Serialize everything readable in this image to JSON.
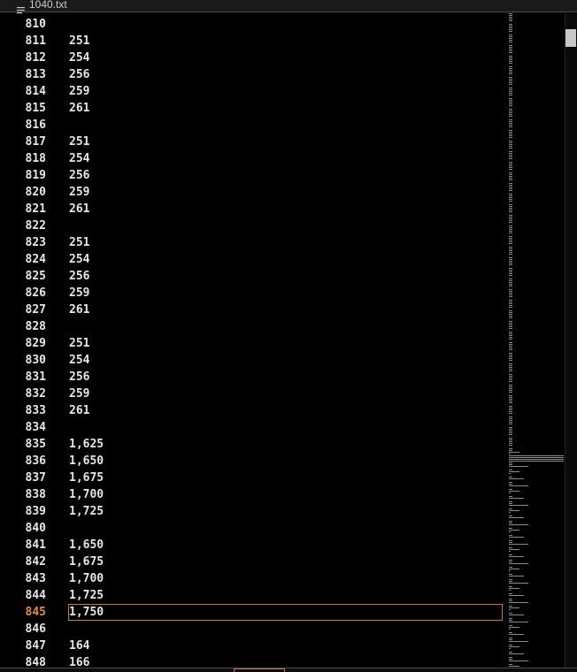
{
  "tab": {
    "title": "1040.txt",
    "icon": "text-file-icon"
  },
  "colors": {
    "background": "#000000",
    "text": "#e6e6e6",
    "current_line_number": "#e08a4e",
    "current_line_border": "#c27a52"
  },
  "editor": {
    "current_line": "845",
    "lines": [
      {
        "n": "810",
        "t": ""
      },
      {
        "n": "811",
        "t": "251"
      },
      {
        "n": "812",
        "t": "254"
      },
      {
        "n": "813",
        "t": "256"
      },
      {
        "n": "814",
        "t": "259"
      },
      {
        "n": "815",
        "t": "261"
      },
      {
        "n": "816",
        "t": ""
      },
      {
        "n": "817",
        "t": "251"
      },
      {
        "n": "818",
        "t": "254"
      },
      {
        "n": "819",
        "t": "256"
      },
      {
        "n": "820",
        "t": "259"
      },
      {
        "n": "821",
        "t": "261"
      },
      {
        "n": "822",
        "t": ""
      },
      {
        "n": "823",
        "t": "251"
      },
      {
        "n": "824",
        "t": "254"
      },
      {
        "n": "825",
        "t": "256"
      },
      {
        "n": "826",
        "t": "259"
      },
      {
        "n": "827",
        "t": "261"
      },
      {
        "n": "828",
        "t": ""
      },
      {
        "n": "829",
        "t": "251"
      },
      {
        "n": "830",
        "t": "254"
      },
      {
        "n": "831",
        "t": "256"
      },
      {
        "n": "832",
        "t": "259"
      },
      {
        "n": "833",
        "t": "261"
      },
      {
        "n": "834",
        "t": ""
      },
      {
        "n": "835",
        "t": "1,625"
      },
      {
        "n": "836",
        "t": "1,650"
      },
      {
        "n": "837",
        "t": "1,675"
      },
      {
        "n": "838",
        "t": "1,700"
      },
      {
        "n": "839",
        "t": "1,725"
      },
      {
        "n": "840",
        "t": ""
      },
      {
        "n": "841",
        "t": "1,650"
      },
      {
        "n": "842",
        "t": "1,675"
      },
      {
        "n": "843",
        "t": "1,700"
      },
      {
        "n": "844",
        "t": "1,725"
      },
      {
        "n": "845",
        "t": "1,750"
      },
      {
        "n": "846",
        "t": ""
      },
      {
        "n": "847",
        "t": "164"
      },
      {
        "n": "848",
        "t": "166"
      }
    ]
  }
}
